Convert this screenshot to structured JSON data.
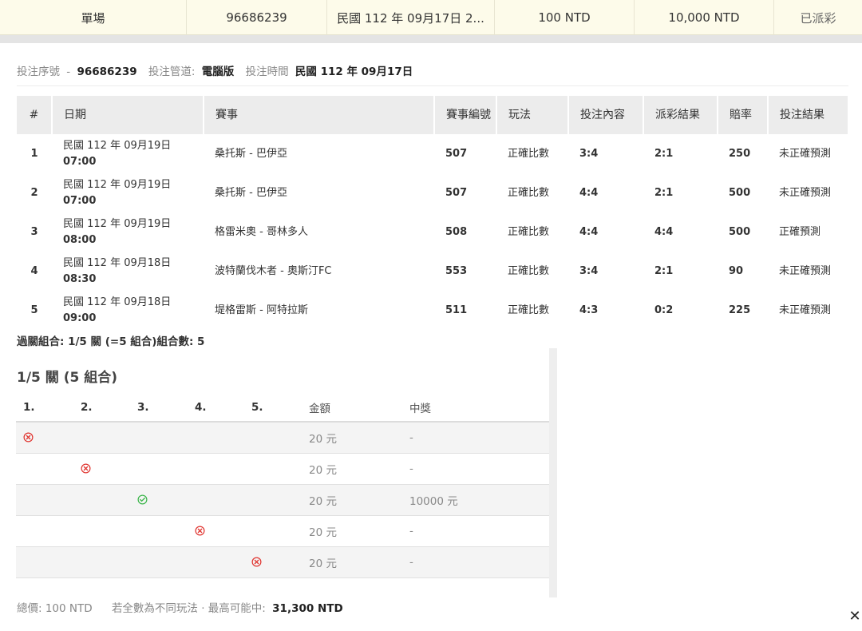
{
  "summary": {
    "cells": [
      "單場",
      "96686239",
      "民國 112 年 09月17日 2...",
      "100 NTD",
      "10,000 NTD",
      "已派彩"
    ]
  },
  "info": {
    "serial_label": "投注序號",
    "serial_sep": "-",
    "serial_value": "96686239",
    "channel_label": "投注管道:",
    "channel_value": "電腦版",
    "time_label": "投注時間",
    "time_value": "民國 112 年 09月17日"
  },
  "bet_table": {
    "headers": [
      "#",
      "日期",
      "賽事",
      "賽事編號",
      "玩法",
      "投注內容",
      "派彩結果",
      "賠率",
      "投注結果"
    ],
    "rows": [
      {
        "no": "1",
        "date": "民國 112 年 09月19日",
        "time": "07:00",
        "match": "桑托斯 - 巴伊亞",
        "match_id": "507",
        "play": "正確比數",
        "pick": "3:4",
        "result": "2:1",
        "odds": "250",
        "outcome": "未正確預測"
      },
      {
        "no": "2",
        "date": "民國 112 年 09月19日",
        "time": "07:00",
        "match": "桑托斯 - 巴伊亞",
        "match_id": "507",
        "play": "正確比數",
        "pick": "4:4",
        "result": "2:1",
        "odds": "500",
        "outcome": "未正確預測"
      },
      {
        "no": "3",
        "date": "民國 112 年 09月19日",
        "time": "08:00",
        "match": "格雷米奧 - 哥林多人",
        "match_id": "508",
        "play": "正確比數",
        "pick": "4:4",
        "result": "4:4",
        "odds": "500",
        "outcome": "正確預測"
      },
      {
        "no": "4",
        "date": "民國 112 年 09月18日",
        "time": "08:30",
        "match": "波特蘭伐木者 - 奧斯汀FC",
        "match_id": "553",
        "play": "正確比數",
        "pick": "3:4",
        "result": "2:1",
        "odds": "90",
        "outcome": "未正確預測"
      },
      {
        "no": "5",
        "date": "民國 112 年 09月18日",
        "time": "09:00",
        "match": "堤格雷斯 - 阿特拉斯",
        "match_id": "511",
        "play": "正確比數",
        "pick": "4:3",
        "result": "0:2",
        "odds": "225",
        "outcome": "未正確預測"
      }
    ]
  },
  "combo_line": "過關組合: 1/5 關 (=5 組合)組合數: 5",
  "combo": {
    "title": "1/5 關 (5 組合)",
    "headers": [
      "1.",
      "2.",
      "3.",
      "4.",
      "5.",
      "金額",
      "中獎"
    ],
    "rows": [
      {
        "col": 0,
        "status": "lose",
        "amount": "20 元",
        "win": "-"
      },
      {
        "col": 1,
        "status": "lose",
        "amount": "20 元",
        "win": "-"
      },
      {
        "col": 2,
        "status": "win",
        "amount": "20 元",
        "win": "10000 元"
      },
      {
        "col": 3,
        "status": "lose",
        "amount": "20 元",
        "win": "-"
      },
      {
        "col": 4,
        "status": "lose",
        "amount": "20 元",
        "win": "-"
      }
    ]
  },
  "footer": {
    "total_label": "總價: 100 NTD",
    "note": "若全數為不同玩法 · 最高可能中:",
    "max_win": "31,300 NTD"
  },
  "close_symbol": "✕",
  "colors": {
    "lose": "#e0342f",
    "win": "#3bb54a",
    "summary_bg": "#fdfbea"
  }
}
